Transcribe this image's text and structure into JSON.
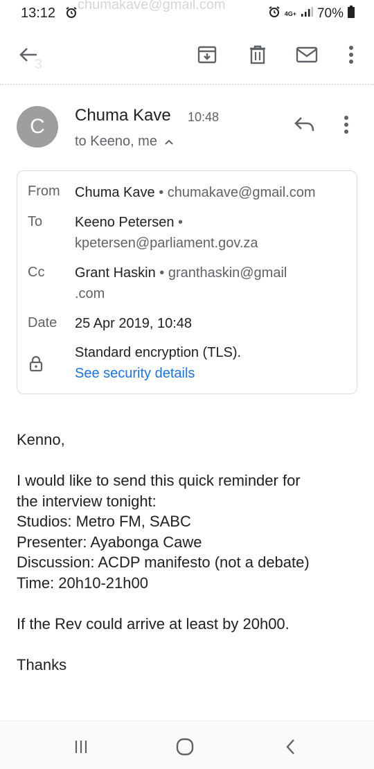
{
  "status_bar": {
    "time": "13:12",
    "ghost_text": "chumakave@gmail.com",
    "network": "4G+",
    "battery": "70%"
  },
  "toolbar": {
    "back_icon": "arrow-back-icon",
    "archive_icon": "archive-icon",
    "delete_icon": "trash-icon",
    "unread_icon": "mail-icon",
    "more_icon": "more-vert-icon",
    "ghost_text": "3"
  },
  "message": {
    "avatar_letter": "C",
    "avatar_color": "#9e9e9e",
    "sender_name": "Chuma Kave",
    "time": "10:48",
    "recipients": "to Keeno, me"
  },
  "details": {
    "from_label": "From",
    "from_name": "Chuma Kave",
    "from_email": "chumakave@gmail.com",
    "to_label": "To",
    "to_name": "Keeno Petersen",
    "to_email": "kpetersen@parliament.gov.za",
    "cc_label": "Cc",
    "cc_name": "Grant Haskin",
    "cc_email_1": "granthaskin@gmail",
    "cc_email_2": ".com",
    "date_label": "Date",
    "date_value": "25 Apr 2019, 10:48",
    "encryption": "Standard encryption (TLS).",
    "security_link": "See security details",
    "separator": "•"
  },
  "body": {
    "lines": [
      "Kenno,",
      "",
      "I would like to send this quick reminder for",
      "the interview tonight:",
      "Studios: Metro FM, SABC",
      "Presenter: Ayabonga Cawe",
      "Discussion: ACDP manifesto (not a debate)",
      "Time: 20h10-21h00",
      "",
      "If the Rev could arrive at least by 20h00.",
      "",
      "Thanks"
    ]
  },
  "colors": {
    "link": "#1a73e8",
    "icon": "#5f6368",
    "text": "#202124"
  }
}
